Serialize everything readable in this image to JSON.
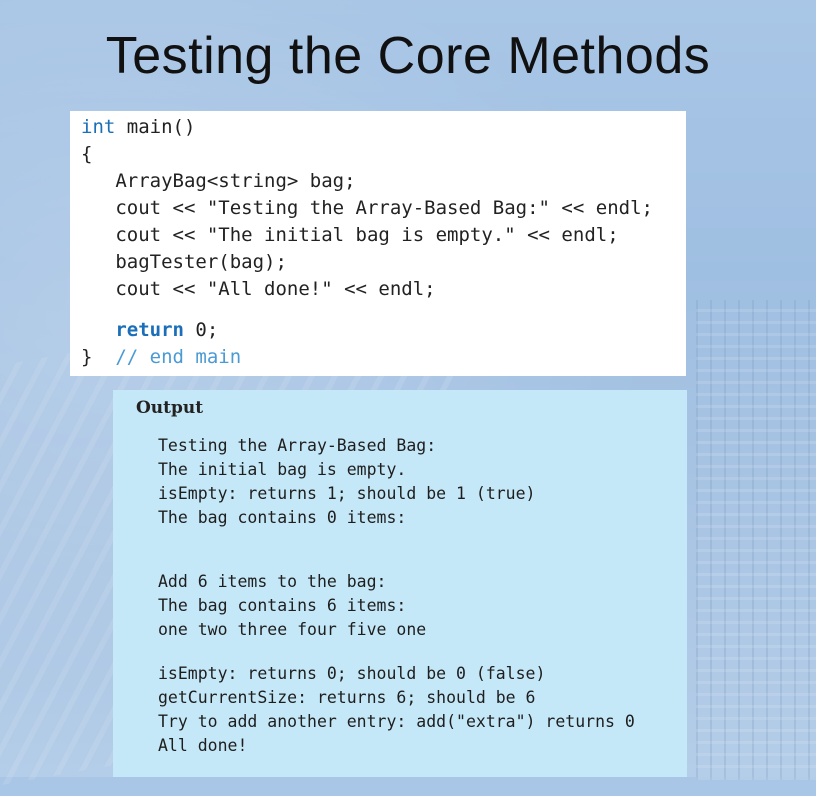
{
  "slide": {
    "title": "Testing the Core Methods"
  },
  "code": {
    "l1_kw": "int",
    "l1_rest": " main()",
    "l2": "{",
    "l3": "   ArrayBag<string> bag;",
    "l4": "   cout << \"Testing the Array-Based Bag:\" << endl;",
    "l5": "   cout << \"The initial bag is empty.\" << endl;",
    "l6": "   bagTester(bag);",
    "l7": "   cout << \"All done!\" << endl;",
    "l8_indent": "   ",
    "l8_kw": "return",
    "l8_rest": " 0;",
    "l9_brace": "}  ",
    "l9_comment": "// end main"
  },
  "output": {
    "heading": "Output",
    "lines": [
      "Testing the Array-Based Bag:",
      "The initial bag is empty.",
      "isEmpty: returns 1; should be 1 (true)",
      "The bag contains 0 items:",
      "Add 6 items to the bag:",
      "The bag contains 6 items:",
      "one two three four five one",
      "isEmpty: returns 0; should be 0 (false)",
      "getCurrentSize: returns 6; should be 6",
      "Try to add another entry: add(\"extra\") returns 0",
      "All done!"
    ]
  }
}
